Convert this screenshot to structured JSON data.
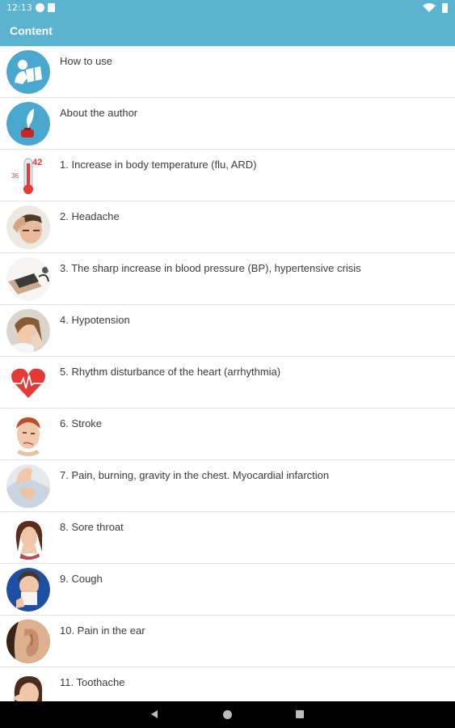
{
  "status": {
    "time": "12:13"
  },
  "app_bar": {
    "title": "Content"
  },
  "items": [
    {
      "label": "How to use",
      "icon": "reading-icon"
    },
    {
      "label": "About the author",
      "icon": "quill-inkpot-icon"
    },
    {
      "label": "1. Increase in body temperature (flu, ARD)",
      "icon": "thermometer-icon",
      "thermo_low": "36",
      "thermo_high": "42"
    },
    {
      "label": "2. Headache",
      "icon": "headache-icon"
    },
    {
      "label": "3. The sharp increase in blood pressure (BP), hypertensive crisis",
      "icon": "blood-pressure-cuff-icon"
    },
    {
      "label": "4. Hypotension",
      "icon": "hypotension-icon"
    },
    {
      "label": "5. Rhythm disturbance of the heart (arrhythmia)",
      "icon": "heart-pulse-icon"
    },
    {
      "label": "6. Stroke",
      "icon": "stroke-face-icon"
    },
    {
      "label": "7. Pain, burning, gravity in the chest. Myocardial infarction",
      "icon": "chest-pain-icon"
    },
    {
      "label": "8. Sore throat",
      "icon": "sore-throat-icon"
    },
    {
      "label": "9. Cough",
      "icon": "cough-icon"
    },
    {
      "label": "10. Pain in the ear",
      "icon": "ear-icon"
    },
    {
      "label": "11. Toothache",
      "icon": "toothache-icon"
    }
  ],
  "colors": {
    "accent": "#5cb3cf",
    "heart": "#e53935"
  }
}
